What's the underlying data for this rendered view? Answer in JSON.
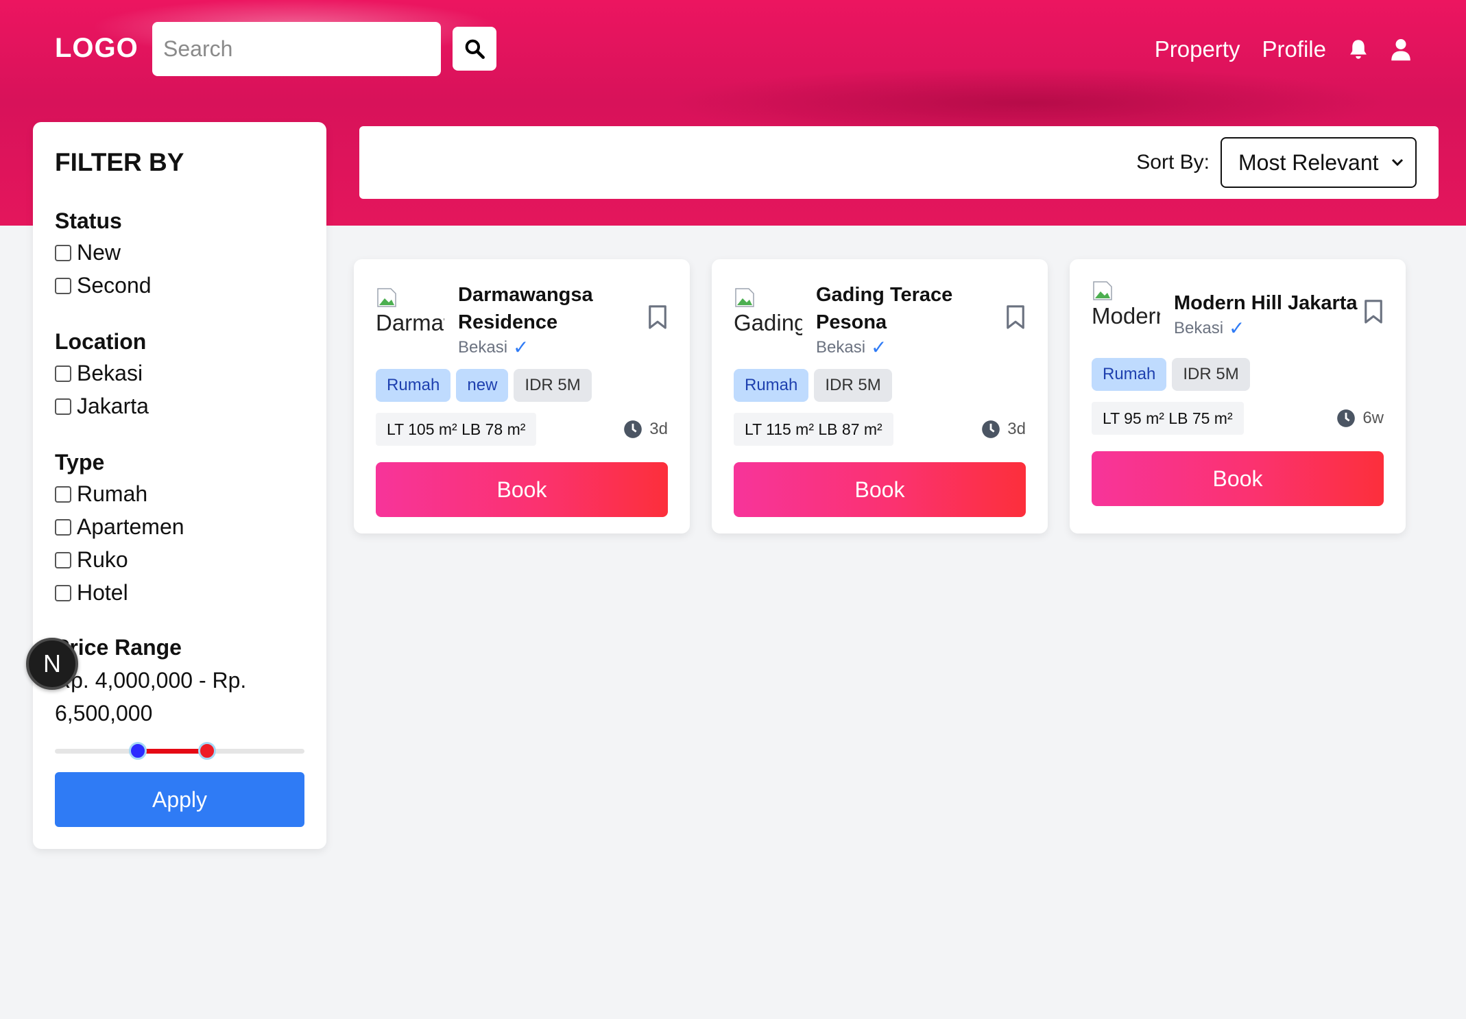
{
  "header": {
    "logo": "LOGO",
    "search_placeholder": "Search",
    "nav": {
      "property": "Property",
      "profile": "Profile"
    }
  },
  "sidebar": {
    "title": "FILTER BY",
    "status": {
      "title": "Status",
      "options": [
        "New",
        "Second"
      ]
    },
    "location": {
      "title": "Location",
      "options": [
        "Bekasi",
        "Jakarta"
      ]
    },
    "type": {
      "title": "Type",
      "options": [
        "Rumah",
        "Apartemen",
        "Ruko",
        "Hotel"
      ]
    },
    "price": {
      "title": "Price Range",
      "text": "Rp. 4,000,000 - Rp. 6,500,000",
      "min_value": 4000000,
      "max_value": 6500000
    },
    "apply_label": "Apply"
  },
  "sort": {
    "label": "Sort By:",
    "selected": "Most Relevant"
  },
  "badge": {
    "letter": "N"
  },
  "colors": {
    "brand": "#e8155f",
    "apply": "#2f7bf5",
    "book_start": "#f7349a",
    "book_end": "#fc2f3b",
    "slider_range": "#e50914",
    "tag_blue": "#bfdbfe"
  },
  "listings": [
    {
      "image_alt": "Darmawangsa Residence",
      "title": "Darmawangsa Residence",
      "location": "Bekasi",
      "tags": [
        "Rumah",
        "new",
        "IDR 5M"
      ],
      "area": "LT 105 m² LB 78 m²",
      "age": "3d",
      "book_label": "Book"
    },
    {
      "image_alt": "Gading Terace Pesona",
      "title": "Gading Terace Pesona",
      "location": "Bekasi",
      "tags": [
        "Rumah",
        "IDR 5M"
      ],
      "area": "LT 115 m² LB 87 m²",
      "age": "3d",
      "book_label": "Book"
    },
    {
      "image_alt": "Modern Hill Jakarta",
      "title": "Modern Hill Jakarta",
      "location": "Bekasi",
      "tags": [
        "Rumah",
        "IDR 5M"
      ],
      "area": "LT 95 m² LB 75 m²",
      "age": "6w",
      "book_label": "Book"
    }
  ]
}
